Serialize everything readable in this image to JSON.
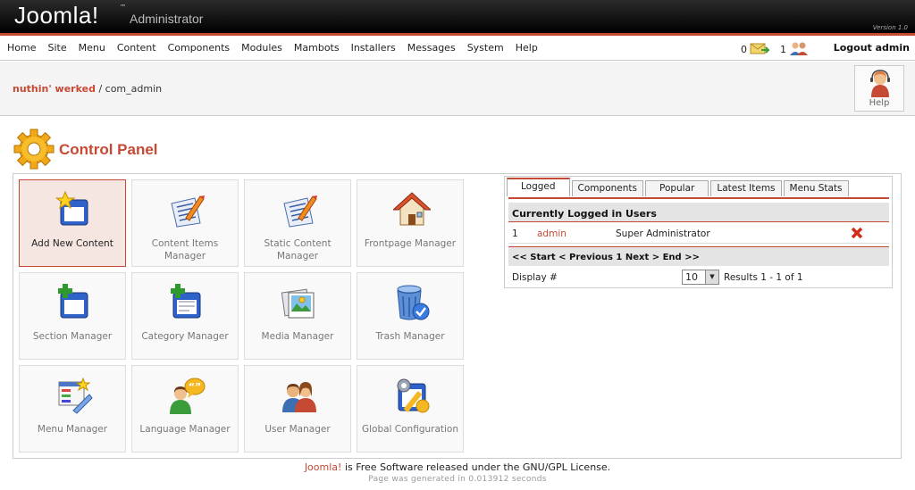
{
  "header": {
    "logo": "Joomla!",
    "trademark": "™",
    "subtitle": "Administrator",
    "version": "Version 1.0"
  },
  "menu": {
    "items": [
      "Home",
      "Site",
      "Menu",
      "Content",
      "Components",
      "Modules",
      "Mambots",
      "Installers",
      "Messages",
      "System",
      "Help"
    ],
    "messages_count": "0",
    "users_count": "1",
    "logout": "Logout admin"
  },
  "pathway": {
    "site": "nuthin' werked",
    "separator": " / ",
    "component": "com_admin"
  },
  "help_button": {
    "label": "Help"
  },
  "title": "Control Panel",
  "icons": [
    {
      "label": "Add New Content",
      "icon": "add-content-icon"
    },
    {
      "label": "Content Items Manager",
      "icon": "content-items-icon"
    },
    {
      "label": "Static Content Manager",
      "icon": "static-content-icon"
    },
    {
      "label": "Frontpage Manager",
      "icon": "frontpage-home-icon"
    },
    {
      "label": "Section Manager",
      "icon": "section-icon"
    },
    {
      "label": "Category Manager",
      "icon": "category-icon"
    },
    {
      "label": "Media Manager",
      "icon": "media-icon"
    },
    {
      "label": "Trash Manager",
      "icon": "trash-icon"
    },
    {
      "label": "Menu Manager",
      "icon": "menu-icon"
    },
    {
      "label": "Language Manager",
      "icon": "language-icon"
    },
    {
      "label": "User Manager",
      "icon": "users-icon"
    },
    {
      "label": "Global Configuration",
      "icon": "config-icon"
    }
  ],
  "tabs": [
    "Logged",
    "Components",
    "Popular",
    "Latest Items",
    "Menu Stats"
  ],
  "logged": {
    "heading": "Currently Logged in Users",
    "row": {
      "num": "1",
      "user": "admin",
      "group": "Super Administrator"
    },
    "nav": "<< Start < Previous 1 Next > End >>",
    "display_label": "Display #",
    "display_value": "10",
    "results": "Results 1 - 1 of 1"
  },
  "footer": {
    "link": "Joomla!",
    "text": " is Free Software released under the GNU/GPL License.",
    "generated": "Page was generated in 0.013912 seconds"
  },
  "colors": {
    "accent": "#c64934",
    "link": "#c64934"
  }
}
